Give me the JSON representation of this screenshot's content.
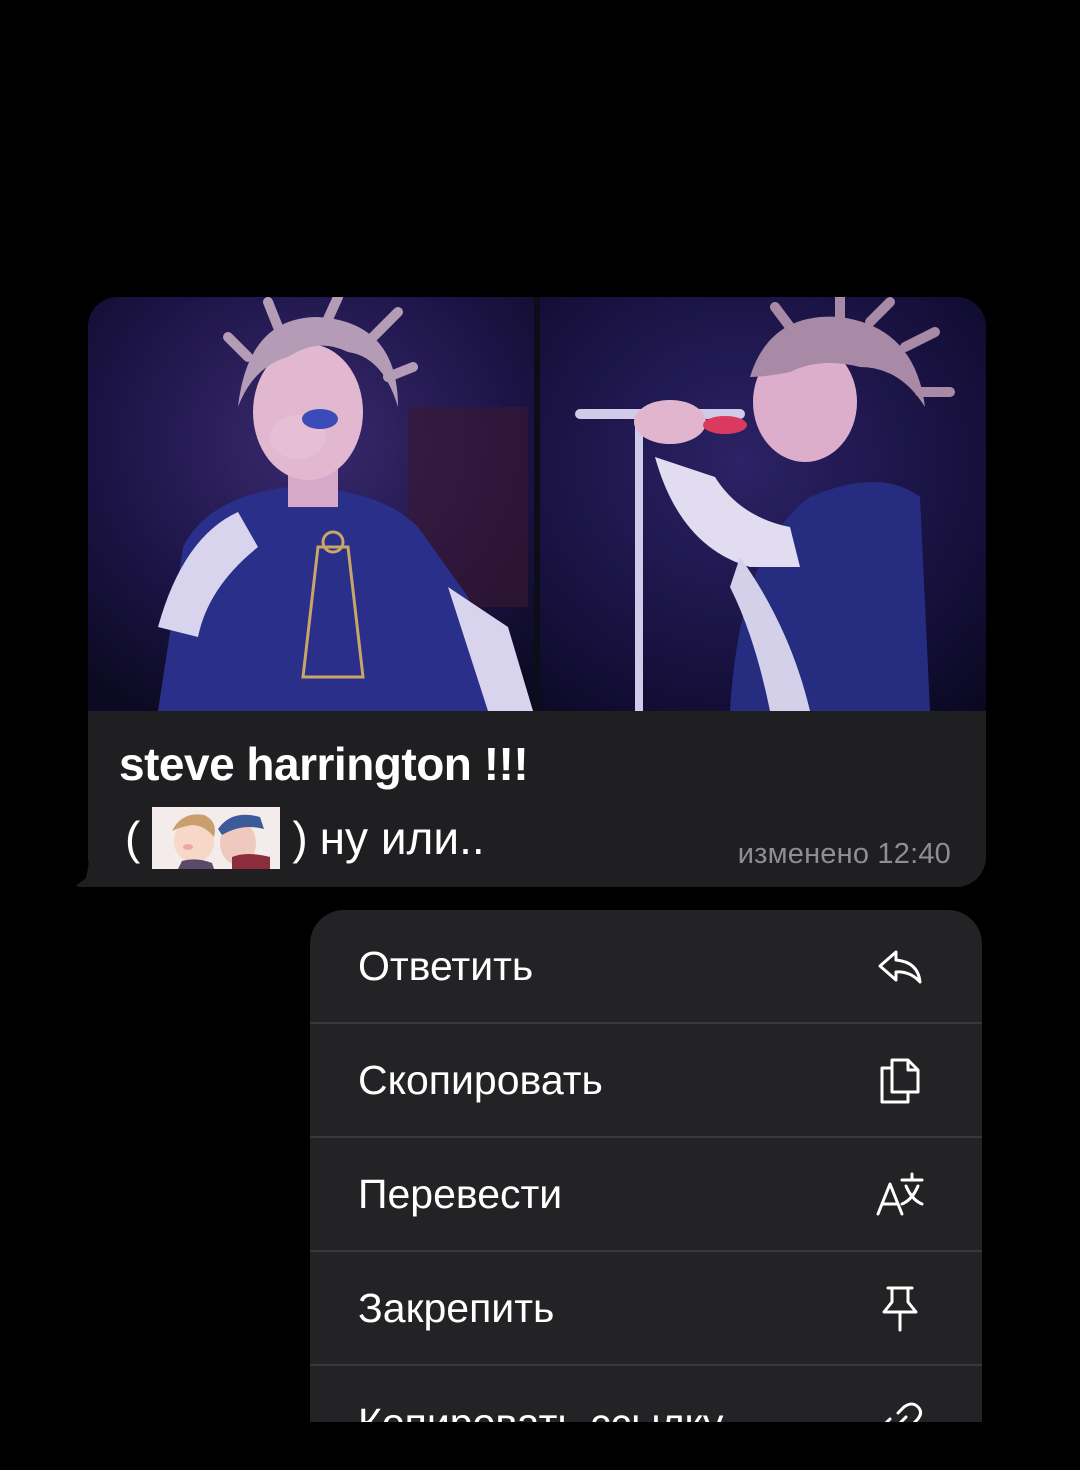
{
  "message": {
    "caption_title": "steve harrington !!!",
    "caption_open_paren": "(",
    "caption_close_paren": ")",
    "caption_text": "ну или..",
    "edited_status": "изменено 12:40",
    "photos": [
      {
        "description_name": "photo-left"
      },
      {
        "description_name": "photo-right"
      }
    ]
  },
  "menu": {
    "items": [
      {
        "label": "Ответить",
        "icon": "reply-icon"
      },
      {
        "label": "Скопировать",
        "icon": "copy-icon"
      },
      {
        "label": "Перевести",
        "icon": "translate-icon"
      },
      {
        "label": "Закрепить",
        "icon": "pin-icon"
      },
      {
        "label": "Копировать ссылку",
        "icon": "link-icon"
      }
    ]
  },
  "colors": {
    "background": "#000000",
    "bubble": "#1f1f21",
    "menu": "#232325",
    "separator": "#38383a",
    "secondary_text": "#8e8e93"
  }
}
